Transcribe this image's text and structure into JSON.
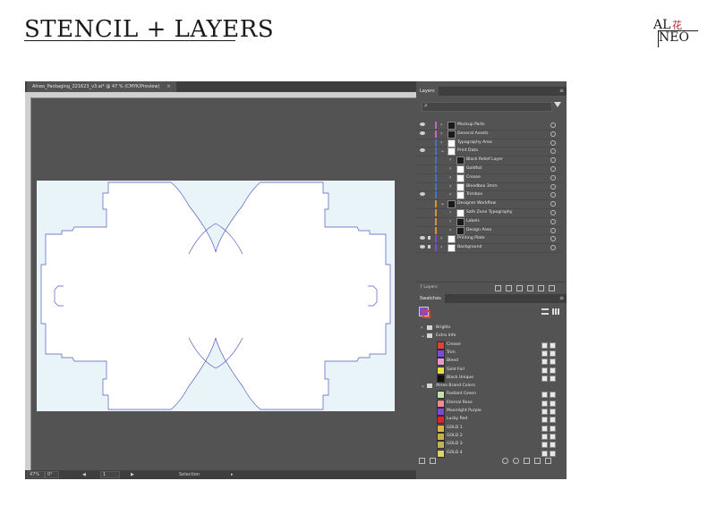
{
  "slide": {
    "title": "STENCIL + LAYERS",
    "logo_top": "AL",
    "logo_han": "花",
    "logo_bottom": "NEO"
  },
  "document": {
    "tab_title": "Alneo_Packaging_221623_v3.ai* @ 47 % (CMYK/Preview)",
    "tab_close": "×"
  },
  "statusbar": {
    "zoom": "47%",
    "angle": "0°",
    "artboard": "1",
    "tool": "Selection"
  },
  "layers_panel": {
    "tab": "Layers",
    "menu": "≡",
    "search_placeholder": "",
    "rows": [
      {
        "name": "Mockup Parts",
        "color": "#c06bc0",
        "indent": 0,
        "eye": true,
        "lock": false,
        "chev": "›",
        "thumb": "#1a1a1a"
      },
      {
        "name": "General Assets",
        "color": "#c06bc0",
        "indent": 0,
        "eye": true,
        "lock": false,
        "chev": "›",
        "thumb": "#1a1a1a"
      },
      {
        "name": "Typography Area",
        "color": "#4a6bd0",
        "indent": 0,
        "eye": false,
        "lock": false,
        "chev": "›",
        "thumb": "#ffffff"
      },
      {
        "name": "Print Data",
        "color": "#4a6bd0",
        "indent": 0,
        "eye": true,
        "lock": false,
        "chev": "⌄",
        "thumb": "#ffffff"
      },
      {
        "name": "Black Relief Layer",
        "color": "#4a6bd0",
        "indent": 1,
        "eye": false,
        "lock": false,
        "chev": "›",
        "thumb": "#1a1a1a"
      },
      {
        "name": "Goldfoil",
        "color": "#4a6bd0",
        "indent": 1,
        "eye": false,
        "lock": false,
        "chev": "›",
        "thumb": "#ffffff"
      },
      {
        "name": "Crease",
        "color": "#4a6bd0",
        "indent": 1,
        "eye": false,
        "lock": false,
        "chev": "›",
        "thumb": "#ffffff"
      },
      {
        "name": "Bleedbox 3mm",
        "color": "#4a6bd0",
        "indent": 1,
        "eye": false,
        "lock": false,
        "chev": "›",
        "thumb": "#ffffff"
      },
      {
        "name": "Trimbox",
        "color": "#4a6bd0",
        "indent": 1,
        "eye": true,
        "lock": false,
        "chev": "›",
        "thumb": "#ffffff"
      },
      {
        "name": "Designer Workflow",
        "color": "#e0902a",
        "indent": 0,
        "eye": false,
        "lock": false,
        "chev": "⌄",
        "thumb": "#1a1a1a"
      },
      {
        "name": "Safe Zone Typography",
        "color": "#e0902a",
        "indent": 1,
        "eye": false,
        "lock": false,
        "chev": "›",
        "thumb": "#ffffff"
      },
      {
        "name": "Labels",
        "color": "#e0902a",
        "indent": 1,
        "eye": false,
        "lock": false,
        "chev": "›",
        "thumb": "#1a1a1a"
      },
      {
        "name": "Design Area",
        "color": "#e0902a",
        "indent": 1,
        "eye": false,
        "lock": false,
        "chev": "›",
        "thumb": "#1a1a1a"
      },
      {
        "name": "Printing Plate",
        "color": "#7a4bd8",
        "indent": 0,
        "eye": true,
        "lock": true,
        "chev": "›",
        "thumb": "#ffffff"
      },
      {
        "name": "Background",
        "color": "#7a4bd8",
        "indent": 0,
        "eye": true,
        "lock": true,
        "chev": "›",
        "thumb": "#ffffff"
      }
    ],
    "footer_count": "7 Layers"
  },
  "swatches_panel": {
    "tab": "Swatches",
    "menu": "≡",
    "rows": [
      {
        "type": "group",
        "name": "Brights",
        "chev": "›"
      },
      {
        "type": "group",
        "name": "Extra Info",
        "chev": "⌄"
      },
      {
        "type": "swatch",
        "name": "Crease",
        "color": "#e0403a"
      },
      {
        "type": "swatch",
        "name": "Trim",
        "color": "#7a4bd8"
      },
      {
        "type": "swatch",
        "name": "Bleed",
        "color": "#e89ac8"
      },
      {
        "type": "swatch",
        "name": "Gold Foil",
        "color": "#e8dc4a"
      },
      {
        "type": "swatch",
        "name": "Black Unique",
        "color": "#111111"
      },
      {
        "type": "group",
        "name": "Alneo Brand Colors",
        "chev": "⌄"
      },
      {
        "type": "swatch",
        "name": "Radiant Green",
        "color": "#bfe3a8"
      },
      {
        "type": "swatch",
        "name": "Eternal Rose",
        "color": "#f08c8c"
      },
      {
        "type": "swatch",
        "name": "Moonlight Purple",
        "color": "#7a4bd8"
      },
      {
        "type": "swatch",
        "name": "Lucky Red",
        "color": "#d8262a"
      },
      {
        "type": "swatch",
        "name": "GOLD 1",
        "color": "#d9b24a"
      },
      {
        "type": "swatch",
        "name": "GOLD 2",
        "color": "#c9b04a"
      },
      {
        "type": "swatch",
        "name": "GOLD 3",
        "color": "#b8b45a"
      },
      {
        "type": "swatch",
        "name": "GOLD 4",
        "color": "#e0cf6a"
      }
    ]
  }
}
